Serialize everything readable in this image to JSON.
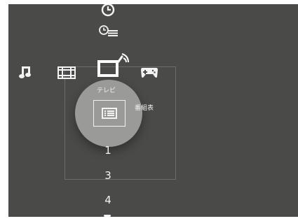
{
  "menu": {
    "icons": [
      "clock-icon",
      "timer-list-icon",
      "music-icon",
      "film-icon",
      "tv-icon",
      "gamepad-icon"
    ],
    "tv_label": "テレビ",
    "guide_label": "番組表"
  },
  "channels": [
    "1",
    "3",
    "4"
  ],
  "colors": {
    "background": "#4a4b49",
    "focus_circle": "#9a9b98",
    "text": "#f3f3f3"
  }
}
